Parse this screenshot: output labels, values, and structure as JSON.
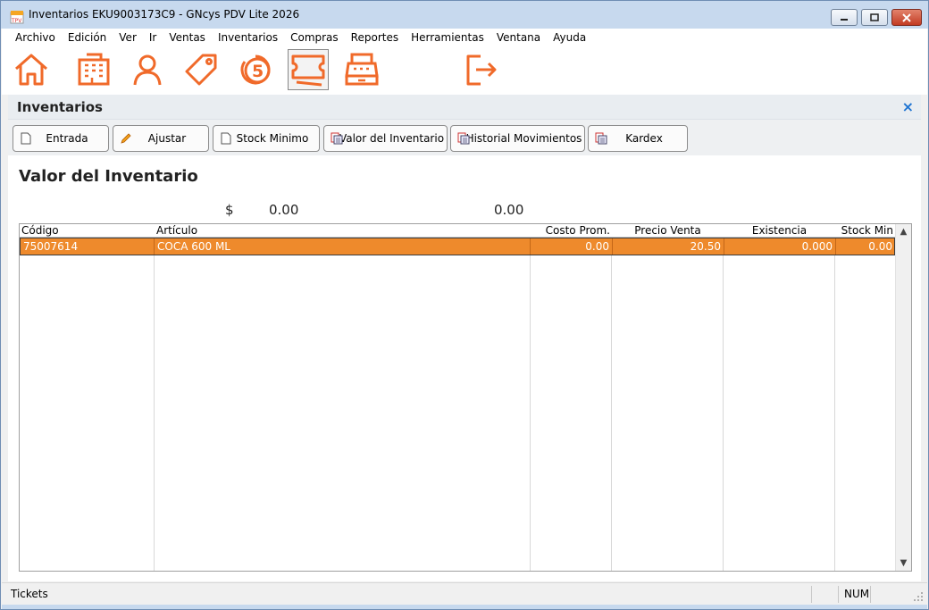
{
  "window": {
    "title": "Inventarios EKU9003173C9 - GNcys PDV Lite 2026"
  },
  "menu": [
    "Archivo",
    "Edición",
    "Ver",
    "Ir",
    "Ventas",
    "Inventarios",
    "Compras",
    "Reportes",
    "Herramientas",
    "Ventana",
    "Ayuda"
  ],
  "toolbar_icons": [
    "home-icon",
    "building-icon",
    "user-icon",
    "tag-icon",
    "coin-icon",
    "ticket-icon",
    "cash-register-icon",
    "exit-icon"
  ],
  "section": {
    "title": "Inventarios",
    "close": "×"
  },
  "actions": {
    "entrada": "Entrada",
    "ajustar": "Ajustar",
    "stock_minimo": "Stock Minimo",
    "valor_inventario": "Valor del Inventario",
    "historial": "Historial Movimientos",
    "kardex": "Kardex"
  },
  "page": {
    "heading": "Valor del Inventario",
    "currency": "$",
    "total_cost": "0.00",
    "total_sale": "0.00"
  },
  "table": {
    "columns": [
      "Código",
      "Artículo",
      "Costo Prom.",
      "Precio Venta",
      "Existencia",
      "Stock Min"
    ],
    "rows": [
      [
        "75007614",
        "COCA 600 ML",
        "0.00",
        "20.50",
        "0.000",
        "0.00"
      ]
    ]
  },
  "status": {
    "left": "Tickets",
    "num": "NUM"
  },
  "colors": {
    "accent": "#ee8a2c",
    "icon": "#f06a2a",
    "close": "#1e74d2"
  }
}
